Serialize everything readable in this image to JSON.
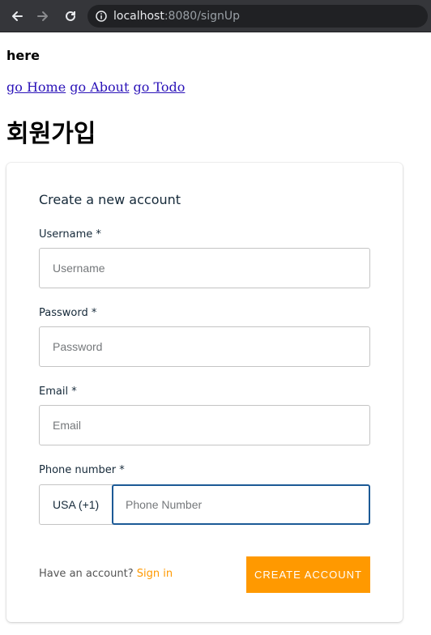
{
  "browser": {
    "url_host": "localhost",
    "url_rest": ":8080/signUp"
  },
  "page": {
    "here_text": "here",
    "nav": [
      "go Home",
      "go About",
      "go Todo"
    ],
    "heading": "회원가입"
  },
  "form": {
    "title": "Create a new account",
    "username": {
      "label": "Username *",
      "placeholder": "Username"
    },
    "password": {
      "label": "Password *",
      "placeholder": "Password"
    },
    "email": {
      "label": "Email *",
      "placeholder": "Email"
    },
    "phone": {
      "label": "Phone number *",
      "country": "USA (+1)",
      "placeholder": "Phone Number"
    },
    "footer_prompt": "Have an account? ",
    "signin_label": "Sign in",
    "submit_label": "CREATE ACCOUNT"
  },
  "colors": {
    "accent": "#ff9900",
    "focus": "#1c5a96"
  }
}
